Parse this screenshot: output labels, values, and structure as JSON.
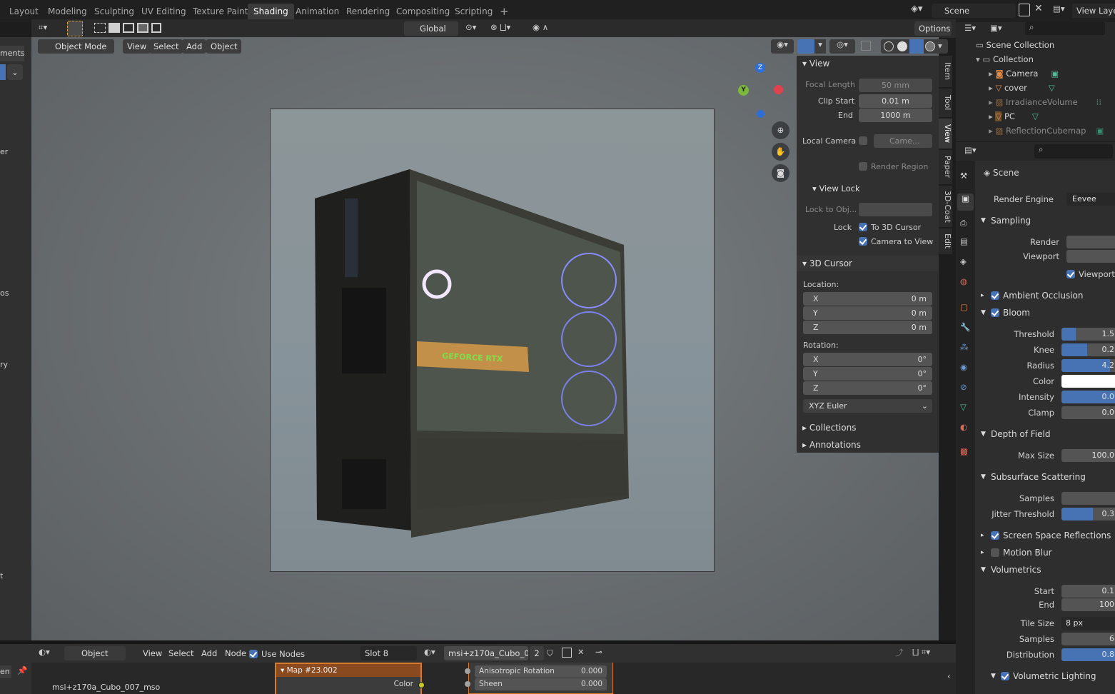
{
  "workspace_tabs": [
    "Layout",
    "Modeling",
    "Sculpting",
    "UV Editing",
    "Texture Paint",
    "Shading",
    "Animation",
    "Rendering",
    "Compositing",
    "Scripting"
  ],
  "active_tab": "Shading",
  "top_right": {
    "scene": "Scene",
    "view_layer": "View Laye"
  },
  "viewport_header": {
    "mode": "Object Mode",
    "menus": [
      "View",
      "Select",
      "Add",
      "Object"
    ],
    "transform": "Global",
    "options": "Options"
  },
  "left_strip": {
    "top_text": "ments\\",
    "fragments": [
      "er",
      "os",
      "ry",
      "t"
    ]
  },
  "npanel": {
    "tabs": [
      "Item",
      "Tool",
      "View",
      "Paper",
      "3D-Coat",
      "Edit"
    ],
    "view_header": "View",
    "focal_length_label": "Focal Length",
    "focal_length": "50 mm",
    "clip_start_label": "Clip Start",
    "clip_start": "0.01 m",
    "end_label": "End",
    "clip_end": "1000 m",
    "local_camera_label": "Local Camera",
    "local_camera_value": "Came...",
    "render_region": "Render Region",
    "view_lock_header": "View Lock",
    "lock_to_obj": "Lock to Obj...",
    "lock_label": "Lock",
    "to_3d_cursor": "To 3D Cursor",
    "camera_to_view": "Camera to View",
    "cursor_header": "3D Cursor",
    "location_label": "Location:",
    "loc": [
      {
        "axis": "X",
        "value": "0 m"
      },
      {
        "axis": "Y",
        "value": "0 m"
      },
      {
        "axis": "Z",
        "value": "0 m"
      }
    ],
    "rotation_label": "Rotation:",
    "rot": [
      {
        "axis": "X",
        "value": "0°"
      },
      {
        "axis": "Y",
        "value": "0°"
      },
      {
        "axis": "Z",
        "value": "0°"
      }
    ],
    "rotation_mode": "XYZ Euler",
    "collections": "Collections",
    "annotations": "Annotations"
  },
  "outliner": {
    "items": [
      {
        "name": "Scene Collection",
        "indent": 0
      },
      {
        "name": "Collection",
        "indent": 1
      },
      {
        "name": "Camera",
        "indent": 2
      },
      {
        "name": "cover",
        "indent": 2
      },
      {
        "name": "IrradianceVolume",
        "indent": 2
      },
      {
        "name": "PC",
        "indent": 2
      },
      {
        "name": "ReflectionCubemap",
        "indent": 2
      }
    ]
  },
  "properties": {
    "scene": "Scene",
    "render_engine_label": "Render Engine",
    "render_engine": "Eevee",
    "sampling": "Sampling",
    "render": "Render",
    "viewport": "Viewport",
    "viewport_denoise": "Viewport D",
    "ambient_occlusion": "Ambient Occlusion",
    "bloom": "Bloom",
    "bloom_rows": [
      {
        "label": "Threshold",
        "value": "1.5",
        "fill": 0.25
      },
      {
        "label": "Knee",
        "value": "0.2",
        "fill": 0.45
      },
      {
        "label": "Radius",
        "value": "4.2",
        "fill": 0.85
      },
      {
        "label": "Color",
        "value": "",
        "fill": 0
      },
      {
        "label": "Intensity",
        "value": "0.0",
        "fill": 1
      },
      {
        "label": "Clamp",
        "value": "0.0",
        "fill": 0
      }
    ],
    "depth_of_field": "Depth of Field",
    "max_size_label": "Max Size",
    "max_size": "100.0",
    "subsurface": "Subsurface Scattering",
    "sss_samples": "Samples",
    "jitter_label": "Jitter Threshold",
    "jitter": "0.3",
    "ssr": "Screen Space Reflections",
    "motion_blur": "Motion Blur",
    "volumetrics": "Volumetrics",
    "vol_start": "Start",
    "vol_start_v": "0.1",
    "vol_end": "End",
    "vol_end_v": "100",
    "tile_size_label": "Tile Size",
    "tile_size": "8 px",
    "vol_samples": "Samples",
    "vol_samples_v": "6",
    "distribution": "Distribution",
    "distribution_v": "0.8",
    "volumetric_lighting": "Volumetric Lighting"
  },
  "node_editor": {
    "object": "Object",
    "menus": [
      "View",
      "Select",
      "Add",
      "Node"
    ],
    "use_nodes": "Use Nodes",
    "slot": "Slot 8",
    "material": "msi+z170a_Cubo_0...",
    "users": "2",
    "node_title": "Map #23.002",
    "node_out": "Color",
    "object_label": "msi+z170a_Cubo_007_mso",
    "bsdf_rows": [
      {
        "label": "Anisotropic Rotation",
        "value": "0.000"
      },
      {
        "label": "Sheen",
        "value": "0.000"
      }
    ],
    "left_frag": "en"
  }
}
